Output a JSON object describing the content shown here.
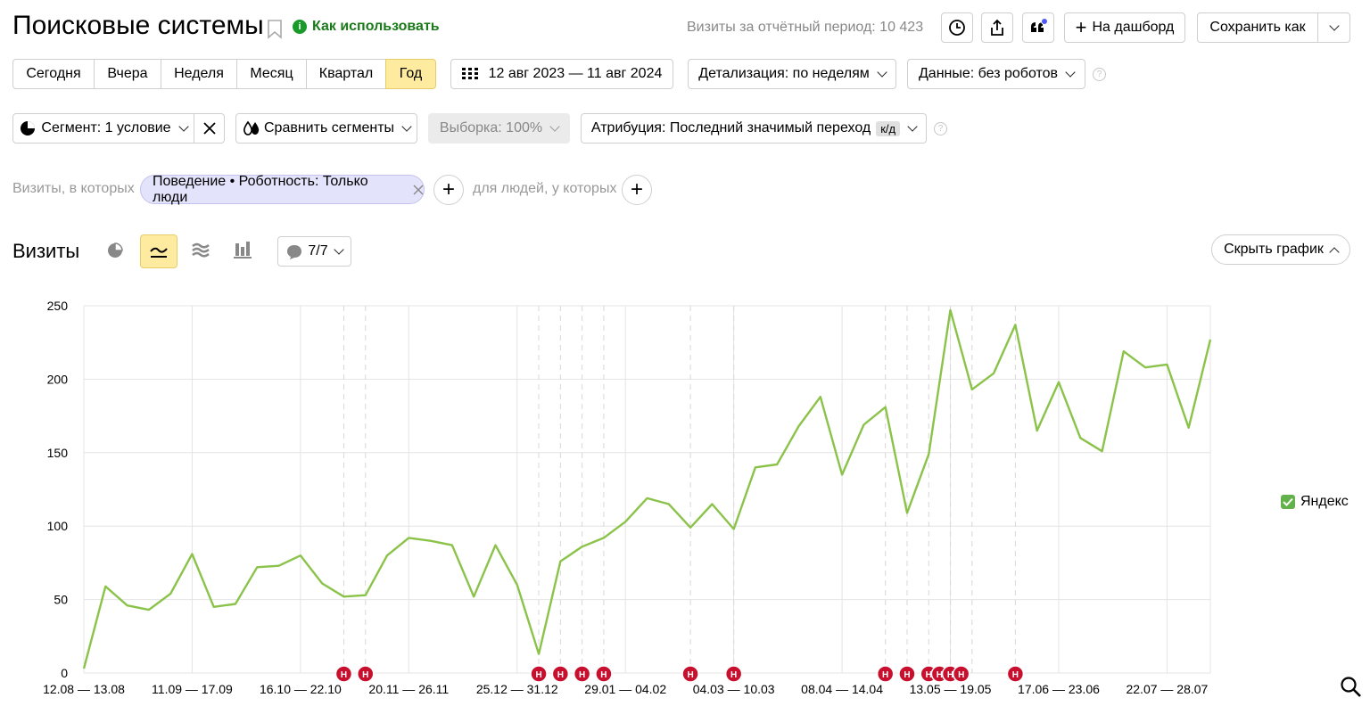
{
  "header": {
    "title": "Поисковые системы",
    "how_to_use": "Как использовать",
    "visits_period": "Визиты за отчётный период: 10 423",
    "dashboard_label": "На дашборд",
    "save_as_label": "Сохранить как"
  },
  "periods": [
    "Сегодня",
    "Вчера",
    "Неделя",
    "Месяц",
    "Квартал",
    "Год"
  ],
  "active_period": "Год",
  "date_range": "12 авг 2023 — 11 авг 2024",
  "detail_label": "Детализация: по неделям",
  "data_label": "Данные: без роботов",
  "segment_label": "Сегмент: 1 условие",
  "compare_label": "Сравнить сегменты",
  "sample_label": "Выборка: 100%",
  "attribution_label": "Атрибуция: Последний значимый переход",
  "attribution_badge": "к/д",
  "filter": {
    "visits_prefix": "Визиты, в которых",
    "chip": "Поведение • Роботность: Только люди",
    "people_prefix": "для людей, у которых"
  },
  "chart_section": {
    "title": "Визиты",
    "annotations_count": "7/7",
    "hide_chart": "Скрыть график"
  },
  "chart_data": {
    "type": "line",
    "title": "",
    "xlabel": "",
    "ylabel": "",
    "ylim": [
      0,
      250
    ],
    "yticks": [
      "0",
      "50",
      "100",
      "150",
      "200",
      "250"
    ],
    "xtick_labels": [
      "12.08 — 13.08",
      "11.09 — 17.09",
      "16.10 — 22.10",
      "20.11 — 26.11",
      "25.12 — 31.12",
      "29.01 — 04.02",
      "04.03 — 10.03",
      "08.04 — 14.04",
      "13.05 — 19.05",
      "17.06 — 23.06",
      "22.07 — 28.07"
    ],
    "grid": true,
    "legend_position": "right",
    "series": [
      {
        "name": "Яндекс",
        "color": "#8bc34a",
        "values": [
          3,
          59,
          46,
          43,
          54,
          81,
          45,
          47,
          72,
          73,
          80,
          61,
          52,
          53,
          80,
          92,
          90,
          87,
          52,
          87,
          60,
          13,
          76,
          86,
          92,
          103,
          119,
          115,
          99,
          115,
          98,
          140,
          142,
          168,
          188,
          135,
          169,
          181,
          109,
          149,
          247,
          193,
          204,
          237,
          165,
          198,
          160,
          151,
          219,
          208,
          210,
          167,
          227
        ]
      }
    ],
    "holiday_marker_label": "Н",
    "holiday_markers_week_index": [
      12,
      13,
      21,
      22,
      23,
      24,
      28,
      30,
      37,
      38,
      39,
      39.5,
      40,
      40.5,
      43
    ]
  },
  "colors": {
    "accent_yellow": "#feeba0",
    "line_green": "#8bc34a",
    "link_green": "#1a7a1a",
    "marker_red": "#c8102e",
    "chip_bg": "#e3e3fb"
  }
}
